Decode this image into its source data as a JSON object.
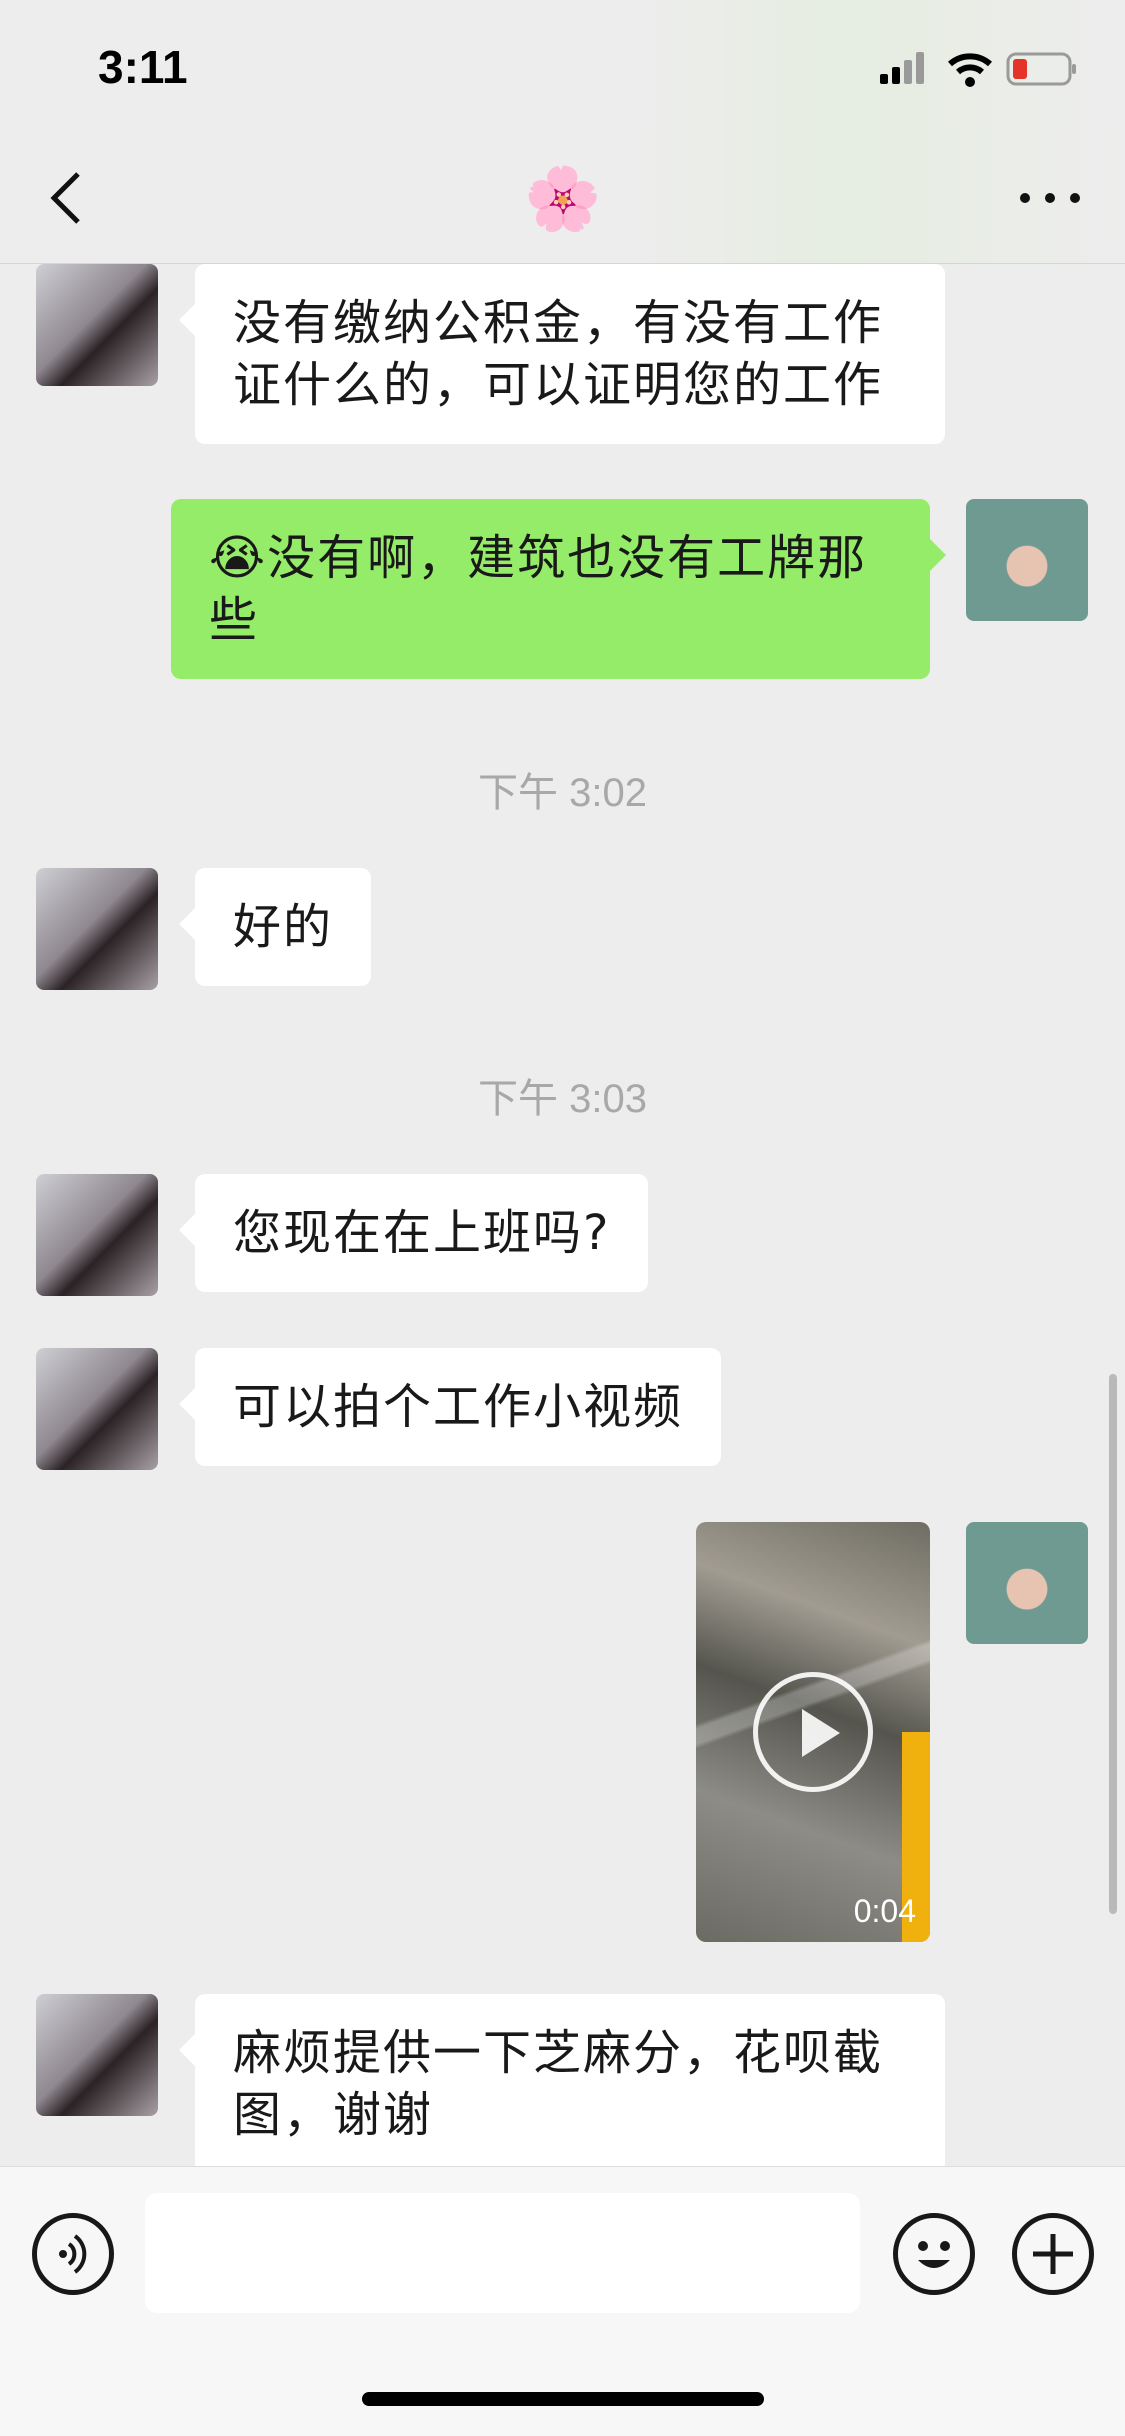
{
  "status_bar": {
    "time": "3:11"
  },
  "nav": {
    "title": "🌸"
  },
  "messages": [
    {
      "text": "没有缴纳公积金，有没有工作证什么的，可以证明您的工作"
    },
    {
      "text": "😭没有啊，建筑也没有工牌那些"
    },
    {
      "text": "好的"
    },
    {
      "text": "您现在在上班吗?"
    },
    {
      "text": "可以拍个工作小视频"
    },
    {
      "text": "麻烦提供一下芝麻分，花呗截图，谢谢"
    }
  ],
  "timestamps": [
    "下午 3:02",
    "下午 3:03"
  ],
  "video": {
    "duration": "0:04"
  },
  "icons": {
    "back": "chevron-left-icon",
    "more": "more-dots-icon",
    "voice": "voice-icon",
    "emoji": "emoji-icon",
    "plus": "plus-icon"
  },
  "colors": {
    "outgoing_bubble": "#95ec69",
    "incoming_bubble": "#ffffff",
    "background": "#ededed"
  }
}
